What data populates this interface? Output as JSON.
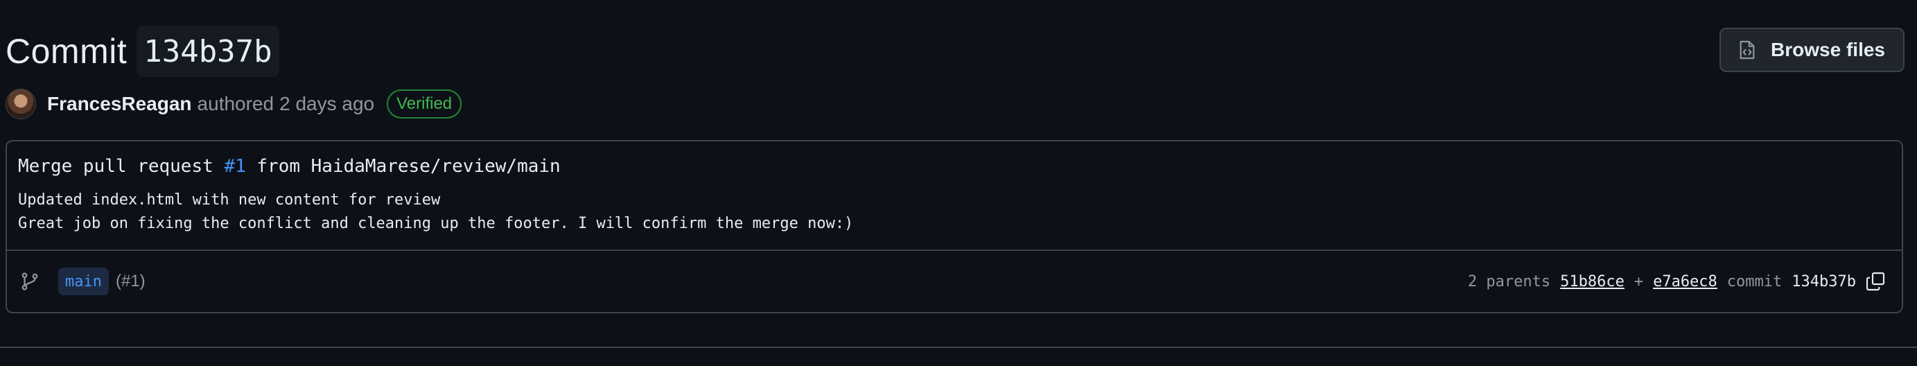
{
  "header": {
    "title_word": "Commit",
    "title_sha": "134b37b",
    "browse_button_label": "Browse files"
  },
  "author": {
    "name": "FrancesReagan",
    "action": "authored",
    "time": "2 days ago",
    "verified_label": "Verified"
  },
  "commit": {
    "title_prefix": "Merge pull request ",
    "pr_ref": "#1",
    "title_suffix": " from HaidaMarese/review/main",
    "description_lines": [
      "Updated index.html with new content for review",
      "Great job on fixing the conflict and cleaning up the footer. I will confirm the merge now:)"
    ]
  },
  "footer": {
    "branch": "main",
    "branch_pr": "(#1)",
    "parents_label": "2 parents",
    "parent_1": "51b86ce",
    "plus": "+",
    "parent_2": "e7a6ec8",
    "commit_label": "commit",
    "commit_sha": "134b37b"
  },
  "icons": {
    "browse": "code-file-icon",
    "branch": "git-branch-icon",
    "copy": "copy-icon"
  },
  "colors": {
    "background": "#0d1117",
    "link": "#4493f8",
    "verified": "#3fb950",
    "border": "#3d444d"
  }
}
